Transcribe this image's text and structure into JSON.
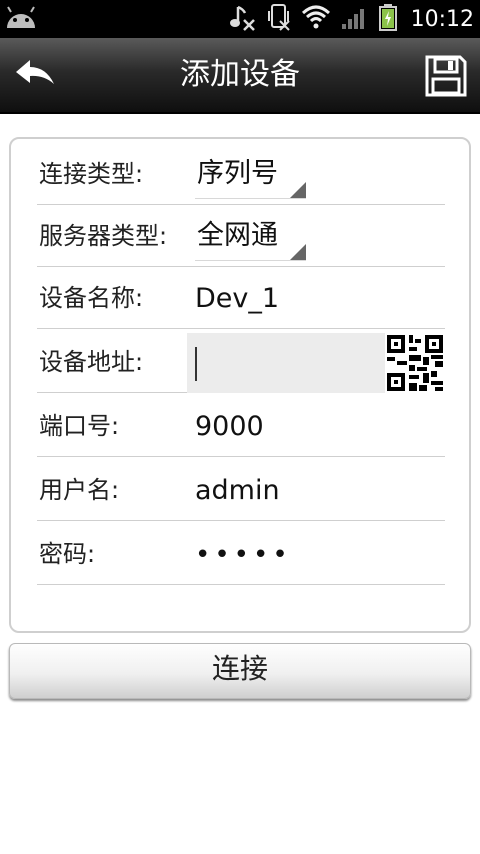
{
  "status_bar": {
    "time": "10:12",
    "icons": [
      "android-icon",
      "music-off-icon",
      "vibrate-icon",
      "wifi-icon",
      "signal-icon",
      "battery-charging-icon"
    ]
  },
  "header": {
    "title": "添加设备",
    "back_icon": "back-arrow-icon",
    "save_icon": "save-icon"
  },
  "form": {
    "connection_type": {
      "label": "连接类型:",
      "value": "序列号"
    },
    "server_type": {
      "label": "服务器类型:",
      "value": "全网通"
    },
    "device_name": {
      "label": "设备名称:",
      "value": "Dev_1"
    },
    "device_address": {
      "label": "设备地址:",
      "value": "",
      "qr_icon": "qr-code-icon"
    },
    "port": {
      "label": "端口号:",
      "value": "9000"
    },
    "username": {
      "label": "用户名:",
      "value": "admin"
    },
    "password": {
      "label": "密码:",
      "value": "•••••"
    }
  },
  "actions": {
    "connect_label": "连接"
  },
  "colors": {
    "title_bar_bg": "#1a1a1a",
    "status_bar_bg": "#000000",
    "card_border": "#cfcfcf",
    "field_bg": "#ececec"
  }
}
